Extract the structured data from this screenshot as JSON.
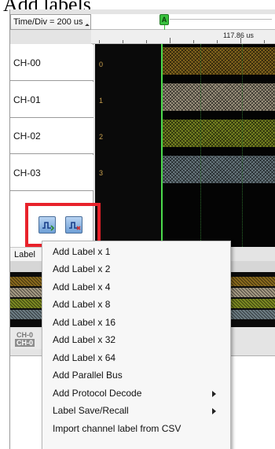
{
  "page_title": "Add labels",
  "time_div": "Time/Div = 200 us",
  "ruler_time": "117.86 us",
  "marker_label": "A",
  "channels": [
    {
      "name": "CH-00",
      "index": "0",
      "color": "#8a6a1e"
    },
    {
      "name": "CH-01",
      "index": "1",
      "color": "#a59a84"
    },
    {
      "name": "CH-02",
      "index": "2",
      "color": "#7c8a22"
    },
    {
      "name": "CH-03",
      "index": "3",
      "color": "#6d7d84"
    }
  ],
  "cursor_color": "#4cdb4c",
  "highlight_color": "#e8222b",
  "label_bar_text": "Label",
  "channel_tab": {
    "top": "CH-0",
    "bottom": "CH-0"
  },
  "context_menu": {
    "items": [
      {
        "label": "Add Label x 1",
        "submenu": false
      },
      {
        "label": "Add Label x 2",
        "submenu": false
      },
      {
        "label": "Add Label x 4",
        "submenu": false
      },
      {
        "label": "Add Label x 8",
        "submenu": false
      },
      {
        "label": "Add Label x 16",
        "submenu": false
      },
      {
        "label": "Add Label x 32",
        "submenu": false
      },
      {
        "label": "Add Label x 64",
        "submenu": false
      },
      {
        "label": "Add Parallel Bus",
        "submenu": false
      },
      {
        "label": "Add Protocol Decode",
        "submenu": true
      },
      {
        "label": "Label Save/Recall",
        "submenu": true
      },
      {
        "label": "Import channel label from CSV",
        "submenu": false
      }
    ]
  }
}
